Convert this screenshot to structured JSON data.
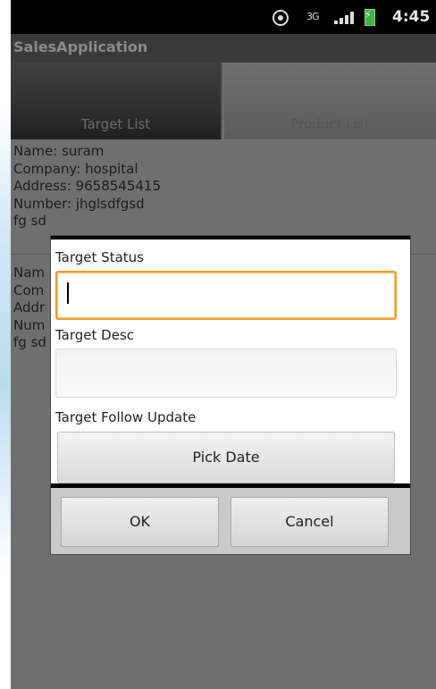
{
  "statusbar": {
    "time": "4:45",
    "network_label": "3G",
    "icons": [
      "gps-icon",
      "network-3g-icon",
      "signal-icon",
      "battery-charging-icon"
    ]
  },
  "app": {
    "title": "SalesApplication"
  },
  "tabs": [
    {
      "label": "Target List",
      "selected": true
    },
    {
      "label": "Product List",
      "selected": false
    }
  ],
  "list": {
    "items": [
      {
        "name": "Name:  suram",
        "company": "Company:  hospital",
        "address": "Address:  9658545415",
        "number": "Number:  jhglsdfgsd",
        "extra": "fg sd"
      },
      {
        "name": "Nam",
        "company": "Com",
        "address": "Addr",
        "number": "Num",
        "extra": "fg sd"
      }
    ]
  },
  "dialog": {
    "status_label": "Target Status",
    "status_value": "",
    "desc_label": "Target Desc",
    "desc_value": "",
    "follow_label": "Target Follow Update",
    "pick_date_label": "Pick Date",
    "ok_label": "OK",
    "cancel_label": "Cancel"
  },
  "colors": {
    "focus_border": "#f59a26",
    "background_dim": "#6f6f6f",
    "battery": "#3fb53f"
  }
}
